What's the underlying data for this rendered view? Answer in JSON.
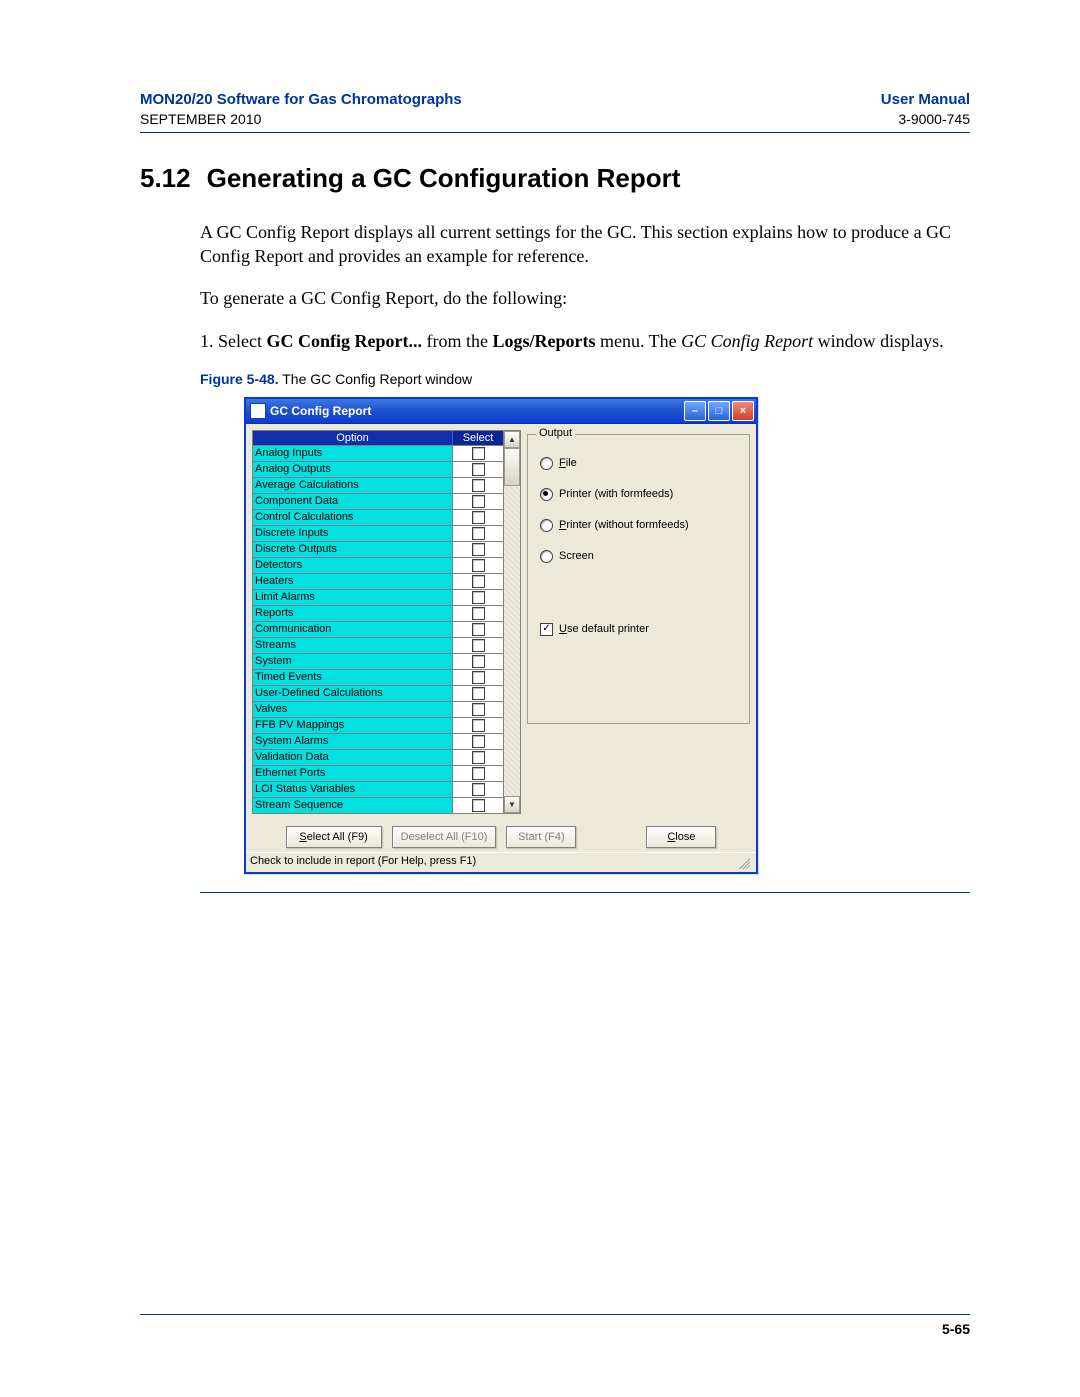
{
  "header": {
    "product": "MON20/20 Software for Gas Chromatographs",
    "manual": "User Manual",
    "date": "SEPTEMBER 2010",
    "docnum": "3-9000-745"
  },
  "section": {
    "num": "5.12",
    "title": "Generating a GC Configuration Report"
  },
  "para1": "A GC Config Report displays all current settings for the GC.  This section explains how to produce a GC Config Report and provides an example for reference.",
  "para2": "To generate a GC Config Report, do the following:",
  "step1": {
    "num": "1.",
    "pre": "Select ",
    "b1": "GC Config Report...",
    "mid": " from the ",
    "b2": "Logs/Reports",
    "post1": " menu.  The ",
    "ital": "GC Config Report",
    "post2": " window displays."
  },
  "figure": {
    "label": "Figure 5-48.",
    "caption": "  The GC Config Report window"
  },
  "dialog": {
    "title": "GC Config Report",
    "columns": {
      "option": "Option",
      "select": "Select"
    },
    "options": [
      "Analog Inputs",
      "Analog Outputs",
      "Average Calculations",
      "Component Data",
      "Control Calculations",
      "Discrete Inputs",
      "Discrete Outputs",
      "Detectors",
      "Heaters",
      "Limit Alarms",
      "Reports",
      "Communication",
      "Streams",
      "System",
      "Timed Events",
      "User-Defined Calculations",
      "Valves",
      "FFB PV Mappings",
      "System Alarms",
      "Validation Data",
      "Ethernet Ports",
      "LOI Status Variables",
      "Stream Sequence"
    ],
    "output": {
      "legend": "Output",
      "file": "File",
      "printer_ff": "Printer (with formfeeds)",
      "printer_noff": "Printer (without formfeeds)",
      "screen": "Screen",
      "use_default": "Use default printer",
      "selected": "printer_ff",
      "use_default_checked": true
    },
    "buttons": {
      "select_all": "Select All (F9)",
      "deselect_all": "Deselect All (F10)",
      "start": "Start (F4)",
      "close": "Close"
    },
    "status": "Check to include in report (For Help, press F1)"
  },
  "pagenum": "5-65"
}
